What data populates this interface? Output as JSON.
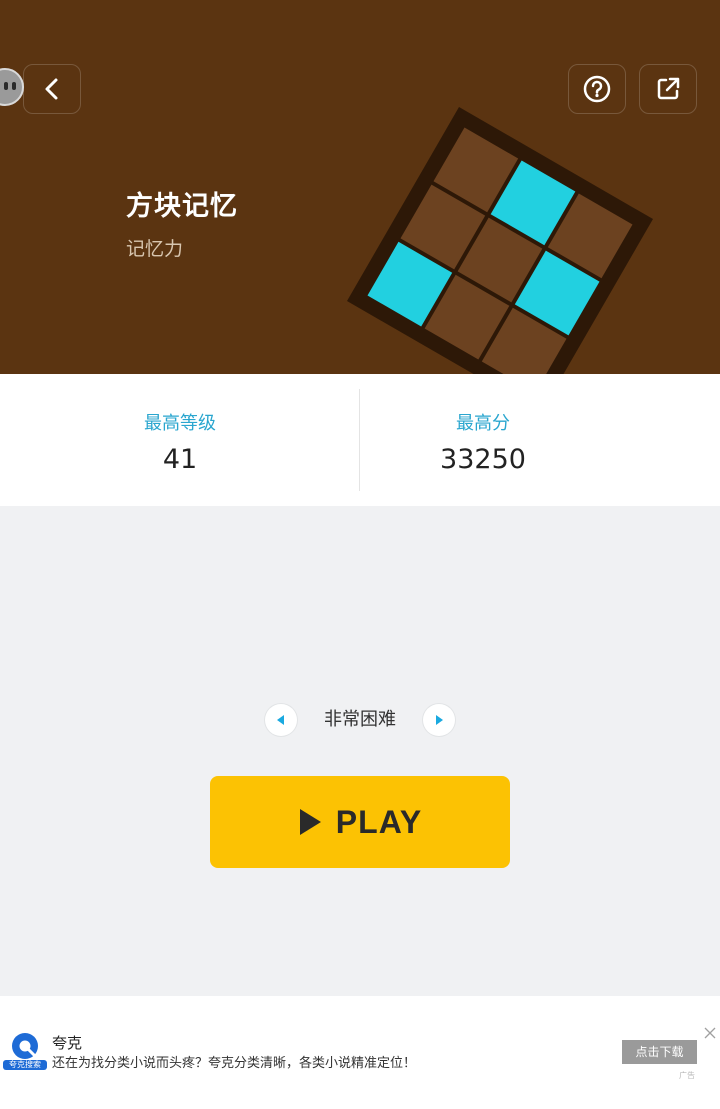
{
  "header": {
    "title": "方块记忆",
    "subtitle": "记忆力",
    "back_icon": "chevron-left-icon",
    "help_icon": "question-circle-icon",
    "share_icon": "external-link-icon",
    "hero_color": "#5b3411"
  },
  "stats": {
    "best_level_label": "最高等级",
    "best_level_value": "41",
    "best_score_label": "最高分",
    "best_score_value": "33250",
    "accent_color": "#2aa6cf"
  },
  "difficulty": {
    "label": "非常困难",
    "prev_icon": "triangle-left-icon",
    "next_icon": "triangle-right-icon"
  },
  "play_button": {
    "label": "PLAY",
    "icon": "play-icon",
    "color": "#fcc203"
  },
  "ad": {
    "brand_badge": "夸克搜索",
    "title": "夸克",
    "description": "还在为找分类小说而头疼？夸克分类清晰，各类小说精准定位！",
    "button_label": "点击下载",
    "ad_mark": "广告",
    "close_icon": "close-icon"
  }
}
